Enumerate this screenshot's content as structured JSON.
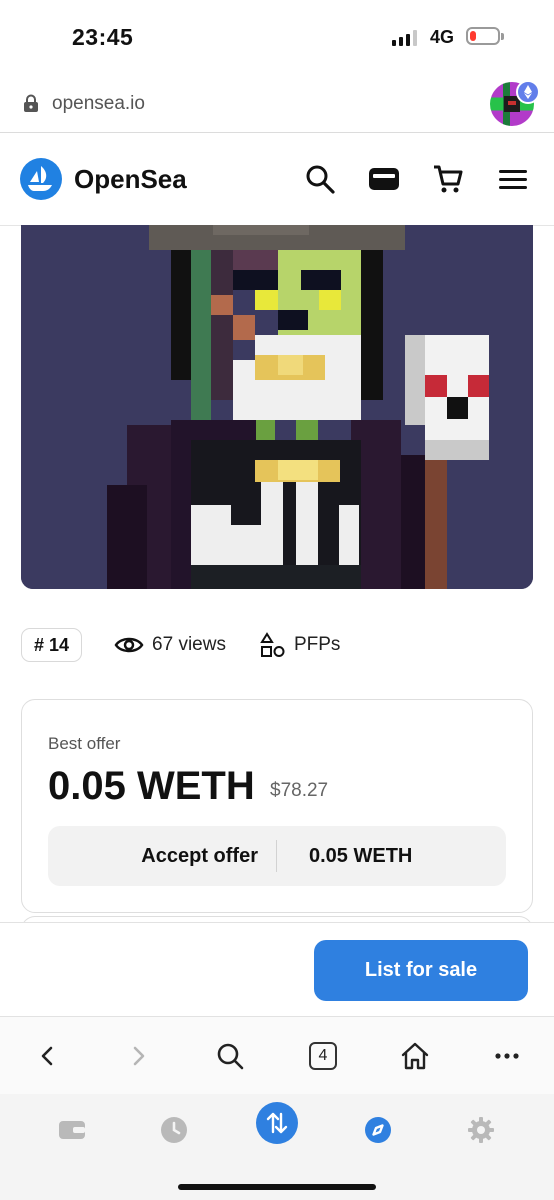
{
  "status_bar": {
    "time": "23:45",
    "network": "4G",
    "battery_color": "#ff3b30"
  },
  "browser": {
    "url": "opensea.io",
    "tabs_count": "4"
  },
  "header": {
    "brand": "OpenSea",
    "brand_color": "#2081e2",
    "icons": [
      "search-icon",
      "wallet-icon",
      "cart-icon",
      "menu-icon"
    ]
  },
  "asset": {
    "number_chip": "# 14",
    "views": "67 views",
    "category": "PFPs"
  },
  "offer": {
    "label": "Best offer",
    "amount": "0.05 WETH",
    "usd": "$78.27",
    "accept_label": "Accept offer",
    "accept_amount": "0.05 WETH"
  },
  "footer": {
    "list_button": "List for sale",
    "accent": "#2f80e0"
  },
  "browser_toolbar": {
    "icons": [
      "back-icon",
      "forward-icon",
      "search-icon",
      "tabs-icon",
      "home-icon",
      "more-icon"
    ]
  },
  "wallet_bar": {
    "icons": [
      "wallet-icon",
      "history-icon",
      "swap-icon",
      "browser-icon",
      "settings-icon"
    ],
    "active_color": "#2f80e0"
  }
}
